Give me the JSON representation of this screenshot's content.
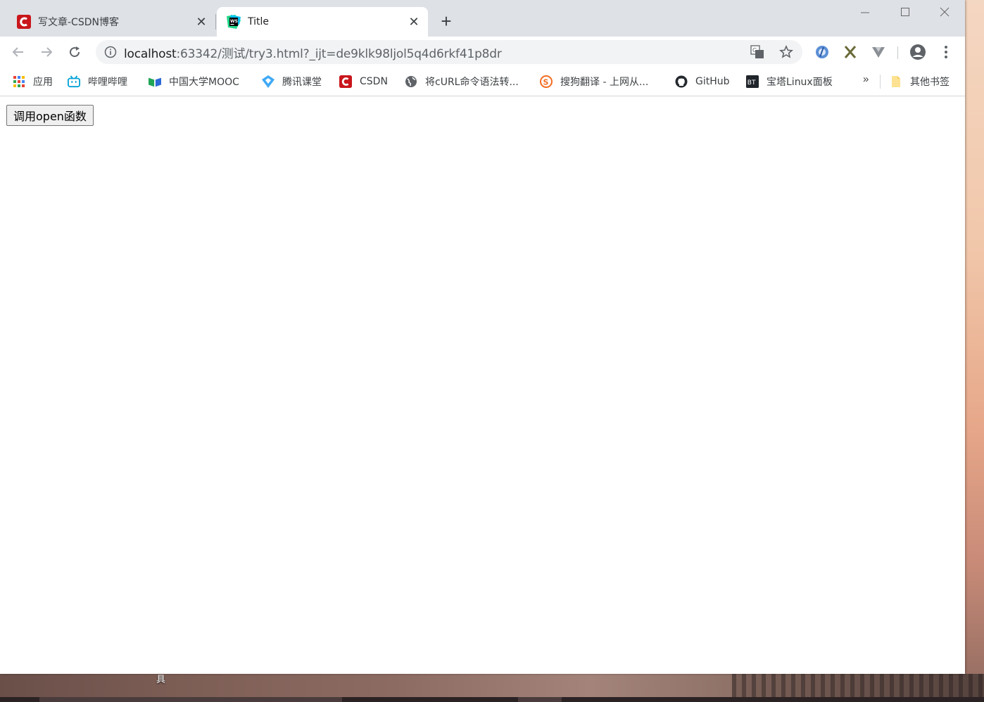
{
  "browser": {
    "tabs": [
      {
        "title": "写文章-CSDN博客",
        "favicon": "csdn-icon",
        "active": false
      },
      {
        "title": "Title",
        "favicon": "webstorm-icon",
        "active": true
      }
    ],
    "new_tab_label": "+",
    "url": {
      "host": "localhost",
      "rest": ":63342/测试/try3.html?_ijt=de9klk98ljol5q4d6rkf41p8dr"
    }
  },
  "bookmarks": {
    "items": [
      {
        "label": "应用",
        "icon": "apps-grid-icon"
      },
      {
        "label": "哔哩哔哩",
        "icon": "bilibili-icon"
      },
      {
        "label": "中国大学MOOC",
        "icon": "mooc-icon"
      },
      {
        "label": "腾讯课堂",
        "icon": "tencent-class-icon"
      },
      {
        "label": "CSDN",
        "icon": "csdn-icon"
      },
      {
        "label": "将cURL命令语法转...",
        "icon": "globe-icon"
      },
      {
        "label": "搜狗翻译 - 上网从...",
        "icon": "sogou-icon"
      },
      {
        "label": "GitHub",
        "icon": "github-icon"
      },
      {
        "label": "宝塔Linux面板",
        "icon": "bt-icon"
      }
    ],
    "more_label": "»",
    "other_label": "其他书签"
  },
  "page": {
    "button_label": "调用open函数"
  },
  "desktop": {
    "label": "具"
  },
  "colors": {
    "tabstrip": "#dee1e6",
    "omnibox": "#f1f3f4",
    "csdn_red": "#c9161c"
  }
}
